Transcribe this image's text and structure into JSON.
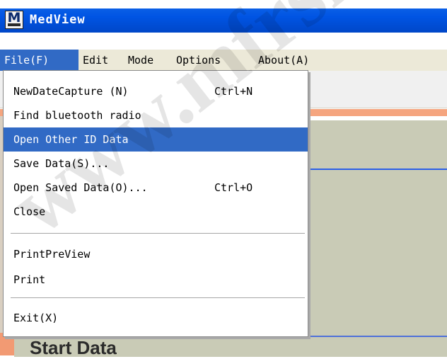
{
  "window": {
    "title": "MedView",
    "icon": "medview-app-icon"
  },
  "menubar": {
    "items": [
      {
        "label": "File(F)"
      },
      {
        "label": "Edit"
      },
      {
        "label": "Mode"
      },
      {
        "label": "Options"
      },
      {
        "label": "About(A)"
      }
    ]
  },
  "file_menu": {
    "items": [
      {
        "label": "NewDateCapture (N)",
        "shortcut": "Ctrl+N"
      },
      {
        "label": "Find bluetooth radio",
        "shortcut": ""
      },
      {
        "label": "Open Other ID Data",
        "shortcut": "",
        "highlighted": true
      },
      {
        "label": "Save Data(S)...",
        "shortcut": ""
      },
      {
        "label": "Open Saved Data(O)...",
        "shortcut": "Ctrl+O"
      },
      {
        "label": "Close",
        "shortcut": ""
      },
      {
        "label": "PrintPreView",
        "shortcut": ""
      },
      {
        "label": "Print",
        "shortcut": ""
      },
      {
        "label": "Exit(X)",
        "shortcut": ""
      }
    ]
  },
  "background": {
    "panel_title": "Start Data"
  },
  "watermark": {
    "text": "www.mfrshop.com"
  },
  "colors": {
    "title_bar": "#0054e3",
    "menu_bar": "#ece9d8",
    "highlight": "#316ac5",
    "panel": "#c9cbb6",
    "accent_orange": "#f5a57f"
  }
}
